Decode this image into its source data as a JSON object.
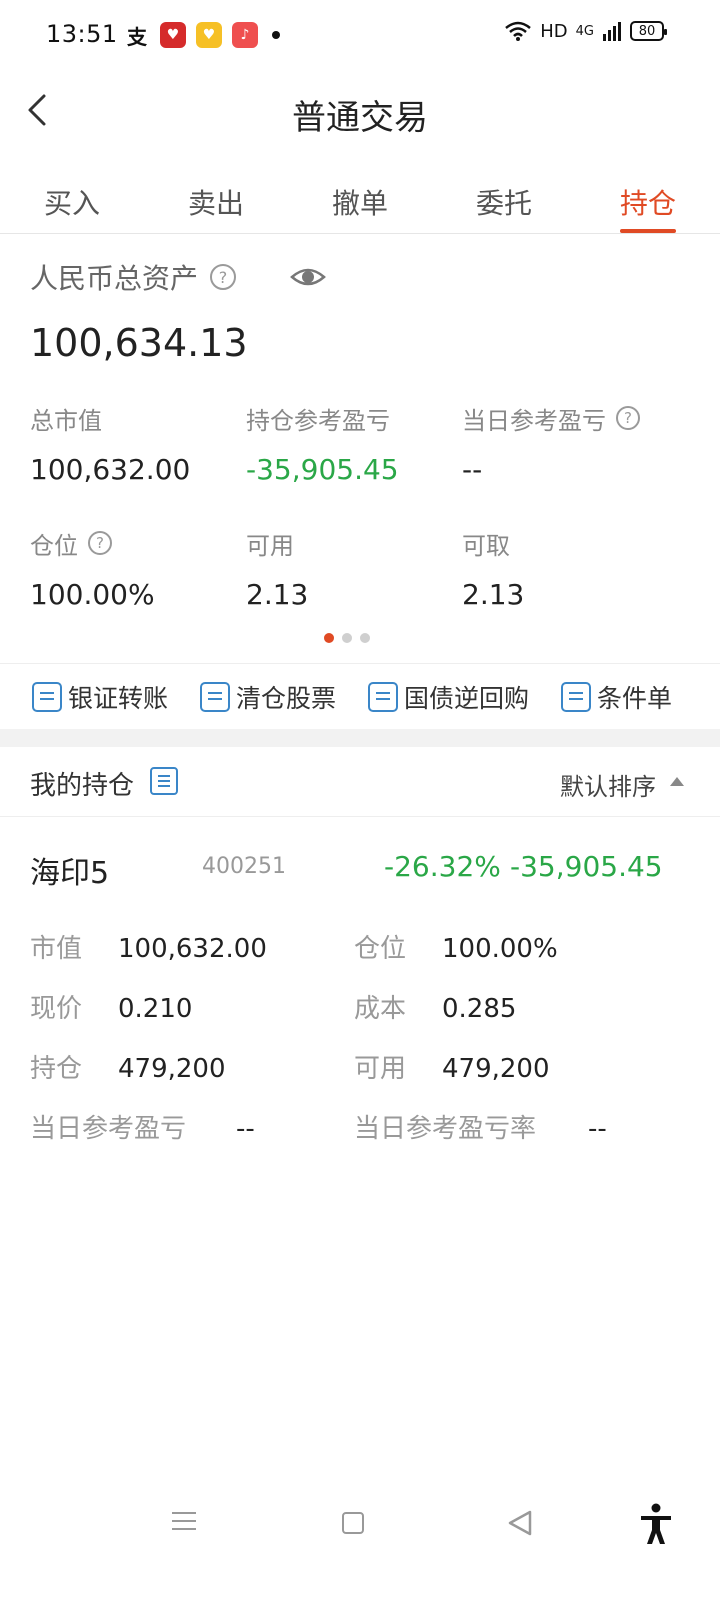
{
  "status_bar": {
    "time": "13:51",
    "app_icon_text": "支",
    "network": "HD",
    "signal": "4G",
    "battery": "80"
  },
  "header": {
    "title": "普通交易"
  },
  "tabs": [
    {
      "label": "买入",
      "active": false
    },
    {
      "label": "卖出",
      "active": false
    },
    {
      "label": "撤单",
      "active": false
    },
    {
      "label": "委托",
      "active": false
    },
    {
      "label": "持仓",
      "active": true
    }
  ],
  "assets": {
    "label": "人民币总资产",
    "total": "100,634.13",
    "stats": {
      "market_value": {
        "label": "总市值",
        "value": "100,632.00"
      },
      "position_pnl": {
        "label": "持仓参考盈亏",
        "value": "-35,905.45"
      },
      "today_pnl": {
        "label": "当日参考盈亏",
        "value": "--"
      },
      "position_ratio": {
        "label": "仓位",
        "value": "100.00%"
      },
      "available": {
        "label": "可用",
        "value": "2.13"
      },
      "withdrawable": {
        "label": "可取",
        "value": "2.13"
      }
    }
  },
  "actions": [
    {
      "label": "银证转账"
    },
    {
      "label": "清仓股票"
    },
    {
      "label": "国债逆回购"
    },
    {
      "label": "条件单"
    }
  ],
  "holdings": {
    "title": "我的持仓",
    "sort_label": "默认排序",
    "items": [
      {
        "name": "海印5",
        "code": "400251",
        "pnl_pct": "-26.32%",
        "pnl": "-35,905.45",
        "fields": {
          "market_value": {
            "label": "市值",
            "value": "100,632.00"
          },
          "position_ratio": {
            "label": "仓位",
            "value": "100.00%"
          },
          "price": {
            "label": "现价",
            "value": "0.210"
          },
          "cost": {
            "label": "成本",
            "value": "0.285"
          },
          "shares": {
            "label": "持仓",
            "value": "479,200"
          },
          "available": {
            "label": "可用",
            "value": "479,200"
          },
          "today_pnl": {
            "label": "当日参考盈亏",
            "value": "--"
          },
          "today_pnl_rate": {
            "label": "当日参考盈亏率",
            "value": "--"
          }
        }
      }
    ]
  },
  "colors": {
    "accent": "#e04a24",
    "loss_green": "#2aa747",
    "action_blue": "#3a86c8"
  }
}
